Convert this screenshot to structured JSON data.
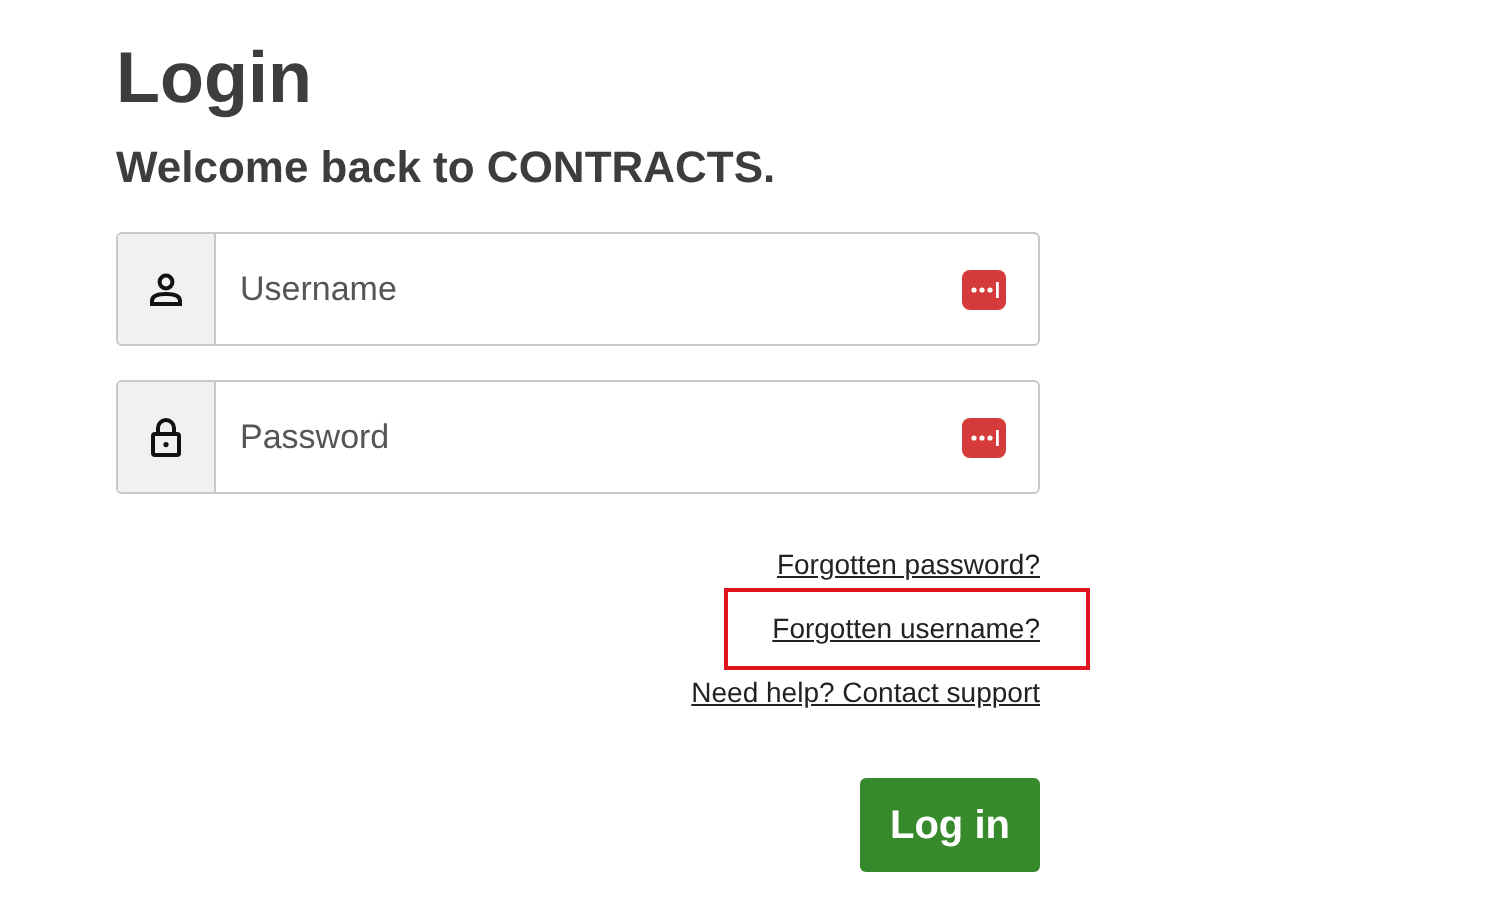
{
  "title": "Login",
  "subtitle": "Welcome back to CONTRACTS.",
  "fields": [
    {
      "kind": "user",
      "placeholder": "Username"
    },
    {
      "kind": "lock",
      "placeholder": "Password"
    }
  ],
  "links": [
    {
      "label": "Forgotten password?",
      "highlighted": false
    },
    {
      "label": "Forgotten username?",
      "highlighted": true
    },
    {
      "label": "Need help? Contact support",
      "highlighted": false
    }
  ],
  "button": "Log in"
}
